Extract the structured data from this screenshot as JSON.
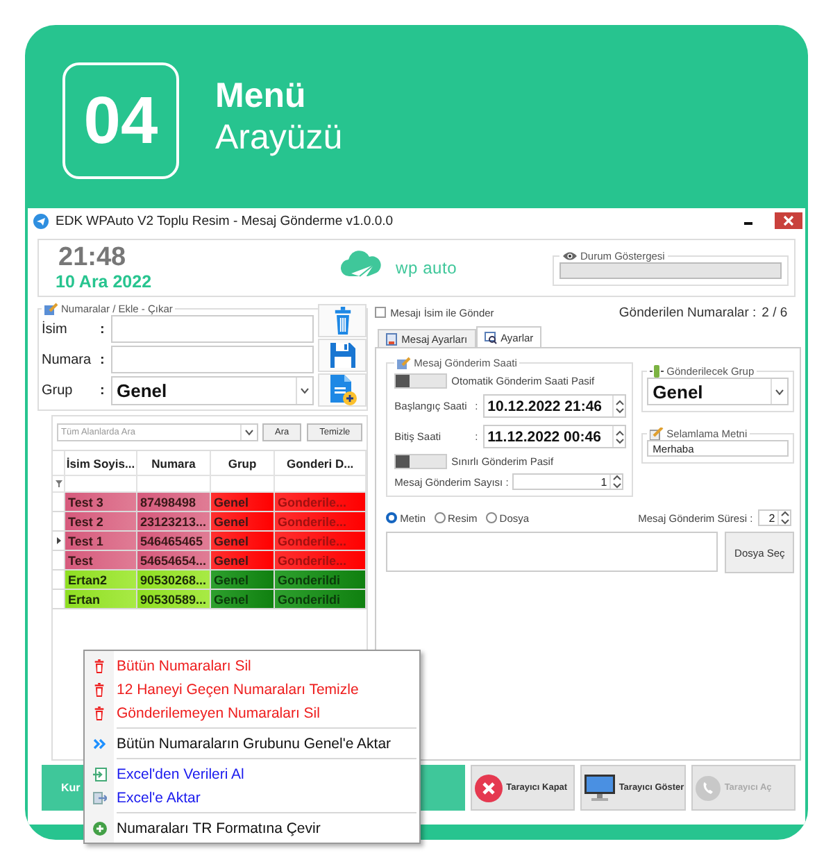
{
  "badge": {
    "number": "04"
  },
  "heading": {
    "title": "Menü",
    "subtitle": "Arayüzü"
  },
  "window": {
    "title": "EDK WPAuto V2 Toplu Resim - Mesaj Gönderme v1.0.0.0"
  },
  "clock": {
    "time": "21:48",
    "date": "10 Ara 2022"
  },
  "logo": {
    "text": "wp auto"
  },
  "status_indicator": {
    "label": "Durum Göstergesi",
    "level": 0
  },
  "numbers_group": {
    "label": "Numaralar / Ekle - Çıkar",
    "fields": [
      {
        "label": "İsim",
        "colon": ":",
        "kind": "text"
      },
      {
        "label": "Numara",
        "colon": ":",
        "kind": "text"
      },
      {
        "label": "Grup",
        "colon": ":",
        "kind": "dropdown",
        "value": "Genel"
      }
    ],
    "actions": [
      {
        "kind": "delete"
      },
      {
        "kind": "save"
      },
      {
        "kind": "add"
      }
    ]
  },
  "search": {
    "placeholder": "Tüm Alanlarda Ara",
    "buttons": [
      "Ara",
      "Temizle"
    ]
  },
  "table": {
    "columns": [
      "İsim Soyis...",
      "Numara",
      "Grup",
      "Gonderi D..."
    ],
    "rows": [
      {
        "kind": "failed",
        "current": false,
        "cells": [
          "Test 3",
          "87498498",
          "Genel",
          "Gonderile..."
        ]
      },
      {
        "kind": "failed",
        "current": false,
        "cells": [
          "Test 2",
          "23123213...",
          "Genel",
          "Gonderile..."
        ]
      },
      {
        "kind": "failed",
        "current": true,
        "cells": [
          "Test 1",
          "546465465",
          "Genel",
          "Gonderile..."
        ]
      },
      {
        "kind": "failed",
        "current": false,
        "cells": [
          "Test",
          "54654654...",
          "Genel",
          "Gonderile..."
        ]
      },
      {
        "kind": "sent",
        "current": false,
        "cells": [
          "Ertan2",
          "90530268...",
          "Genel",
          "Gonderildi"
        ]
      },
      {
        "kind": "sent",
        "current": false,
        "cells": [
          "Ertan",
          "90530589...",
          "Genel",
          "Gonderildi"
        ]
      }
    ]
  },
  "send_with_name": {
    "label": "Mesajı İsim ile Gönder",
    "checked": false
  },
  "sent_count": {
    "label": "Gönderilen Numaralar :",
    "value": "2 / 6"
  },
  "tabs": [
    {
      "label": "Mesaj Ayarları",
      "selected": false
    },
    {
      "label": "Ayarlar",
      "selected": true
    }
  ],
  "schedule": {
    "label": "Mesaj Gönderim Saati",
    "auto_toggle": {
      "label": "Otomatik Gönderim Saati Pasif",
      "on": false
    },
    "start": {
      "label": "Başlangıç Saati",
      "colon": ":",
      "value": "10.12.2022 21:46"
    },
    "end": {
      "label": "Bitiş Saati",
      "colon": ":",
      "value": "11.12.2022 00:46"
    },
    "limit_toggle": {
      "label": "Sınırlı Gönderim Pasif",
      "on": false
    },
    "count": {
      "label": "Mesaj Gönderim Sayısı :",
      "value": "1"
    }
  },
  "target_group": {
    "label": "Gönderilecek Grup",
    "value": "Genel"
  },
  "greeting": {
    "label": "Selamlama Metni",
    "value": "Merhaba"
  },
  "message_types": [
    {
      "label": "Metin",
      "selected": true
    },
    {
      "label": "Resim",
      "selected": false
    },
    {
      "label": "Dosya",
      "selected": false
    }
  ],
  "interval": {
    "label": "Mesaj Gönderim Süresi :",
    "value": "2"
  },
  "file_button": {
    "label": "Dosya Seç"
  },
  "bottom_buttons": [
    {
      "label": "Kur",
      "kind": "primary",
      "disabled": false
    },
    {
      "label": "Tarayıcı Kapat",
      "kind": "close",
      "disabled": false
    },
    {
      "label": "Tarayıcı Göster",
      "kind": "show",
      "disabled": false
    },
    {
      "label": "Tarayıcı Aç",
      "kind": "open",
      "disabled": true
    }
  ],
  "context_menu": {
    "sections": [
      {
        "items": [
          {
            "label": "Bütün Numaraları Sil",
            "kind": "delete",
            "color": "#ee1c1c"
          },
          {
            "label": "12 Haneyi Geçen Numaraları Temizle",
            "kind": "delete",
            "color": "#ee1c1c"
          },
          {
            "label": "Gönderilemeyen Numaraları Sil",
            "kind": "delete",
            "color": "#ee1c1c"
          }
        ]
      },
      {
        "items": [
          {
            "label": "Bütün Numaraların Grubunu Genel'e Aktar",
            "kind": "move",
            "color": "#111111"
          }
        ]
      },
      {
        "items": [
          {
            "label": "Excel'den Verileri Al",
            "kind": "import",
            "color": "#1a1aee"
          },
          {
            "label": "Excel'e Aktar",
            "kind": "export",
            "color": "#1a1aee"
          }
        ]
      },
      {
        "items": [
          {
            "label": "Numaraları TR Formatına Çevir",
            "kind": "convert",
            "color": "#111111"
          }
        ]
      }
    ]
  }
}
